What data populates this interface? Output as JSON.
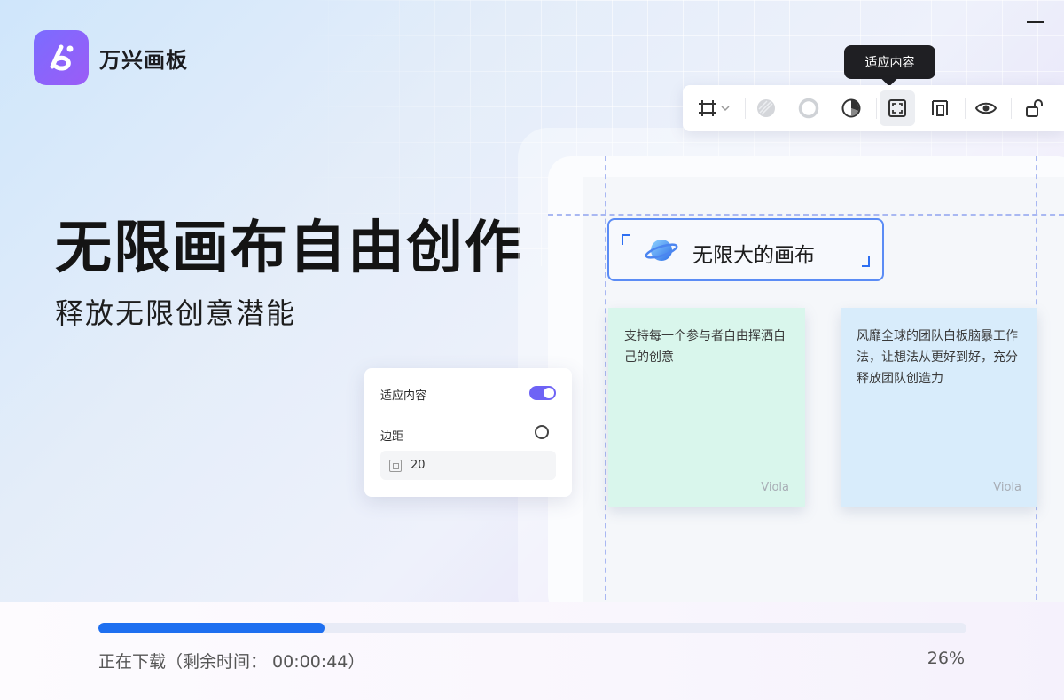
{
  "app": {
    "name": "万兴画板"
  },
  "colors": {
    "accent": "#1e6ff0",
    "brand": "#7b6cff",
    "toggle_on": "#6e63f5"
  },
  "hero": {
    "title": "无限画布自由创作",
    "subtitle": "释放无限创意潜能"
  },
  "toolbar": {
    "tooltip": "适应内容",
    "buttons": [
      {
        "icon": "frame-icon",
        "has_dropdown": true
      },
      {
        "icon": "fill-icon"
      },
      {
        "icon": "stroke-icon"
      },
      {
        "icon": "color-wheel-icon"
      },
      {
        "icon": "fit-content-icon",
        "active": true
      },
      {
        "icon": "align-icon"
      },
      {
        "icon": "eye-icon"
      },
      {
        "icon": "lock-open-icon"
      }
    ]
  },
  "canvas": {
    "title_card": {
      "text": "无限大的画布",
      "icon": "planet-icon"
    },
    "stickies": [
      {
        "text": "支持每一个参与者自由挥洒自己的创意",
        "author": "Viola",
        "color": "#d9f6ec"
      },
      {
        "text": "风靡全球的团队白板脑暴工作法，让想法从更好到好，充分释放团队创造力",
        "author": "Viola",
        "color": "#d8ecfb"
      }
    ]
  },
  "panel": {
    "fit_content_label": "适应内容",
    "fit_content_enabled": true,
    "margin_label": "边距",
    "margin_value": "20"
  },
  "download": {
    "status": "正在下载（剩余时间： 00:00:44）",
    "percent_label": "26%",
    "progress": 0.26
  }
}
